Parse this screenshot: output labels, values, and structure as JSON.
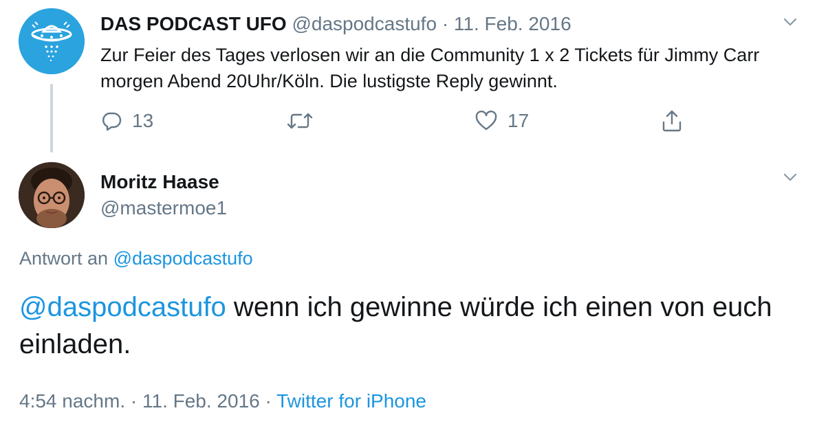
{
  "parent_tweet": {
    "author_name": "DAS PODCAST UFO",
    "author_handle": "@daspodcastufo",
    "separator": "·",
    "date": "11. Feb. 2016",
    "text": "Zur Feier des Tages verlosen wir an die Community 1 x 2 Tickets für Jimmy Carr morgen Abend 20Uhr/Köln. Die lustigste Reply gewinnt.",
    "actions": {
      "reply_count": "13",
      "retweet_count": "",
      "like_count": "17"
    },
    "avatar_color": "#2aa3df"
  },
  "reply_tweet": {
    "author_name": "Moritz Haase",
    "author_handle": "@mastermoe1",
    "reply_to_prefix": "Antwort an",
    "reply_to_handle": "@daspodcastufo",
    "mention": "@daspodcastufo",
    "text": " wenn ich gewinne würde ich einen von euch einladen.",
    "time": "4:54 nachm.",
    "sep1": "·",
    "date": "11. Feb. 2016",
    "sep2": "·",
    "source": "Twitter for iPhone"
  },
  "icons": [
    "caret-down-icon",
    "reply-icon",
    "retweet-icon",
    "like-icon",
    "share-icon",
    "ufo-logo-icon"
  ],
  "colors": {
    "link": "#1b95e0",
    "muted": "#657786",
    "text": "#14171a",
    "thread_line": "#ccd6dd"
  }
}
